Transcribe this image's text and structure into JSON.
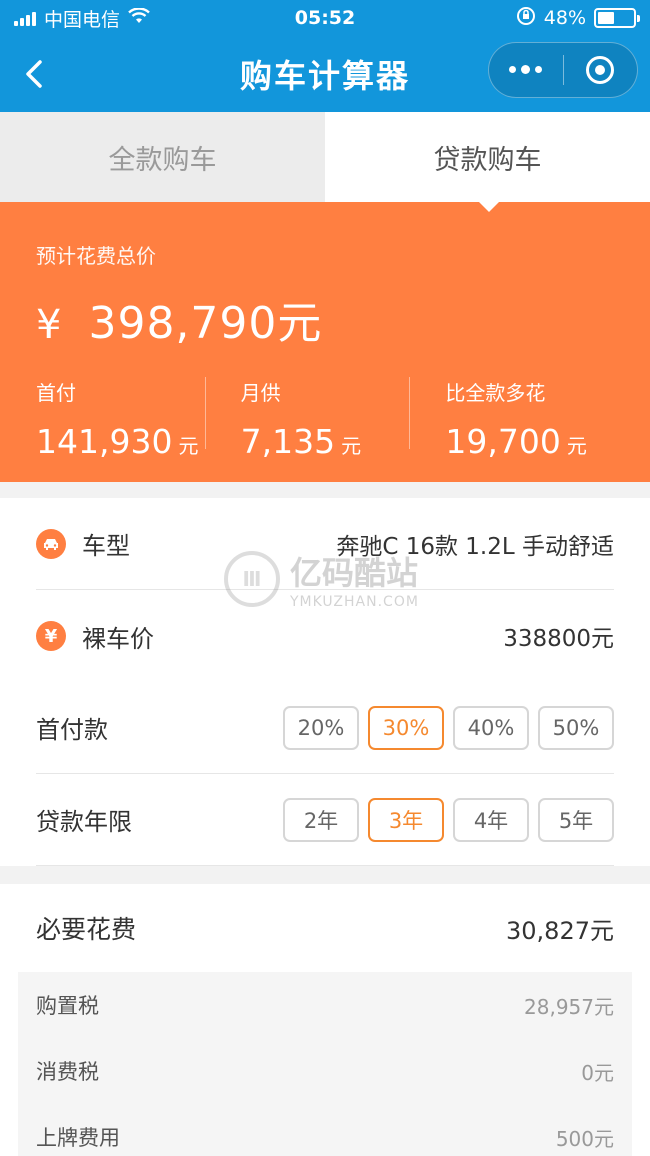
{
  "status_bar": {
    "carrier": "中国电信",
    "time": "05:52",
    "battery": "48%",
    "battery_level": 0.48
  },
  "nav": {
    "title": "购车计算器"
  },
  "tabs": [
    {
      "label": "全款购车",
      "active": false
    },
    {
      "label": "贷款购车",
      "active": true
    }
  ],
  "summary": {
    "label": "预计花费总价",
    "currency_symbol": "¥",
    "total": "398,790元",
    "down_payment": {
      "label": "首付",
      "value": "141,930",
      "unit": "元"
    },
    "monthly": {
      "label": "月供",
      "value": "7,135",
      "unit": "元"
    },
    "extra": {
      "label": "比全款多花",
      "value": "19,700",
      "unit": "元"
    }
  },
  "form": {
    "car_model": {
      "label": "车型",
      "value": "奔驰C 16款 1.2L 手动舒适"
    },
    "bare_price": {
      "label": "裸车价",
      "value": "338800元"
    },
    "down_ratio": {
      "label": "首付款",
      "options": [
        "20%",
        "30%",
        "40%",
        "50%"
      ],
      "selected": "30%"
    },
    "loan_years": {
      "label": "贷款年限",
      "options": [
        "2年",
        "3年",
        "4年",
        "5年"
      ],
      "selected": "3年"
    }
  },
  "watermark": {
    "text": "亿码酷站",
    "sub": "YMKUZHAN.COM"
  },
  "fees": {
    "title": "必要花费",
    "total": "30,827元",
    "items": [
      {
        "label": "购置税",
        "value": "28,957元"
      },
      {
        "label": "消费税",
        "value": "0元"
      },
      {
        "label": "上牌费用",
        "value": "500元"
      }
    ]
  },
  "colors": {
    "nav_blue": "#1296db",
    "accent_orange": "#ff7f41",
    "selected_orange": "#f5892f"
  }
}
